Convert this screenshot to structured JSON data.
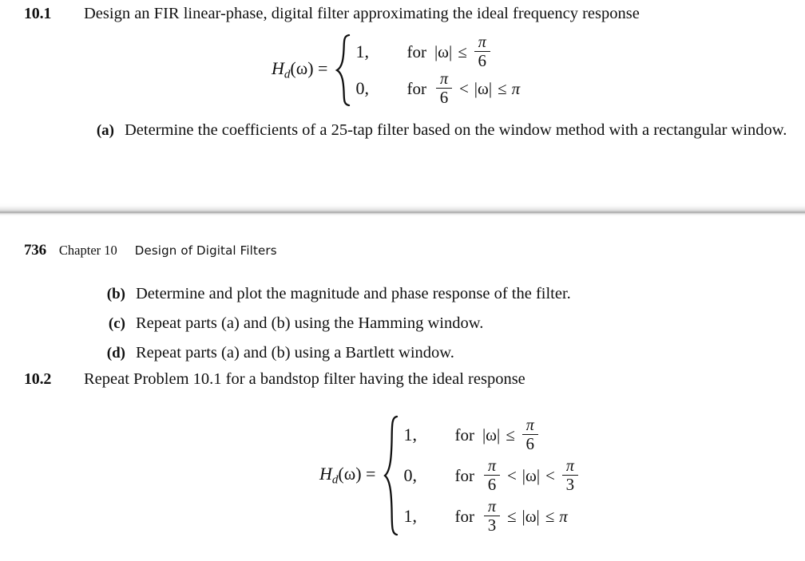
{
  "page": {
    "background": "#ffffff",
    "text_color": "#101010"
  },
  "running_head": {
    "page_number": "736",
    "chapter": "Chapter 10",
    "title": "Design of Digital Filters"
  },
  "problems": [
    {
      "number": "10.1",
      "statement": "Design an FIR linear-phase, digital filter approximating the ideal frequency response",
      "subitems": [
        {
          "label": "(a)",
          "text": "Determine the coefficients of a 25-tap filter based on the window method with a rectangular window."
        },
        {
          "label": "(b)",
          "text": "Determine and plot the magnitude and phase response of the filter."
        },
        {
          "label": "(c)",
          "text": "Repeat parts (a) and (b) using the Hamming window."
        },
        {
          "label": "(d)",
          "text": "Repeat parts (a) and (b) using a Bartlett window."
        }
      ]
    },
    {
      "number": "10.2",
      "statement": "Repeat Problem 10.1 for a bandstop filter having the ideal response",
      "subitems": []
    }
  ],
  "equations": {
    "eq1": {
      "lhs_fn": "H",
      "lhs_sub": "d",
      "lhs_arg": "(ω)",
      "lhs_eq": "=",
      "cases": [
        {
          "value": "1,",
          "for": "for",
          "lhs_expr": "|ω|",
          "relation": "≤",
          "rhs_num": "π",
          "rhs_den": "6",
          "rhs_plain": ""
        },
        {
          "value": "0,",
          "for": "for",
          "lhs_num": "π",
          "lhs_den": "6",
          "relation1": "<",
          "middle": "|ω|",
          "relation2": "≤",
          "rhs_plain": "π"
        }
      ]
    },
    "eq2": {
      "lhs_fn": "H",
      "lhs_sub": "d",
      "lhs_arg": "(ω)",
      "lhs_eq": "=",
      "cases": [
        {
          "value": "1,",
          "for": "for",
          "lhs_expr": "|ω|",
          "relation": "≤",
          "rhs_num": "π",
          "rhs_den": "6"
        },
        {
          "value": "0,",
          "for": "for",
          "lhs_num": "π",
          "lhs_den": "6",
          "relation1": "<",
          "middle": "|ω|",
          "relation2": "<",
          "rhs_num": "π",
          "rhs_den": "3"
        },
        {
          "value": "1,",
          "for": "for",
          "lhs_num": "π",
          "lhs_den": "3",
          "relation1": "≤",
          "middle": "|ω|",
          "relation2": "≤",
          "rhs_plain": "π"
        }
      ]
    }
  }
}
